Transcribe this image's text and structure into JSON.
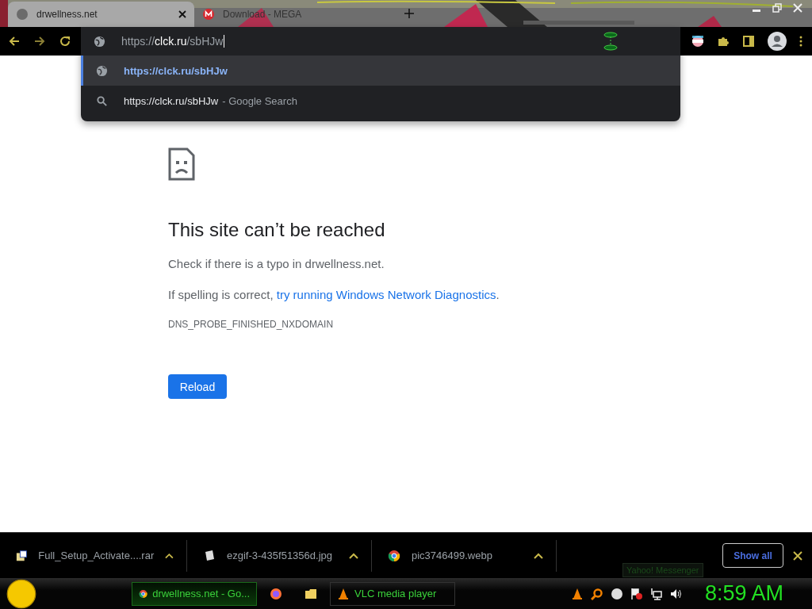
{
  "tabs": [
    {
      "title": "drwellness.net",
      "selected": true,
      "kind": "globe"
    },
    {
      "title": "Download - MEGA",
      "selected": false,
      "kind": "mega"
    }
  ],
  "omnibox": {
    "scheme": "https://",
    "host": "clck.ru",
    "path": "/sbHJw"
  },
  "suggestions": [
    {
      "kind": "url",
      "text": "https://clck.ru/sbHJw",
      "selected": true
    },
    {
      "kind": "search",
      "text": "https://clck.ru/sbHJw",
      "suffix": "- Google Search",
      "selected": false
    }
  ],
  "error": {
    "title": "This site can’t be reached",
    "line_1": "Check if there is a typo in drwellness.net.",
    "line_2_before": "If spelling is correct, ",
    "line_2_link": "try running Windows Network Diagnostics",
    "line_2_after": ".",
    "code": "DNS_PROBE_FINISHED_NXDOMAIN",
    "button": "Reload"
  },
  "downloads": {
    "items": [
      {
        "name": "Full_Setup_Activate....rar",
        "kind": "archive"
      },
      {
        "name": "ezgif-3-435f51356d.jpg"
      },
      {
        "name": "pic3746499.webp",
        "kind": "chrome"
      }
    ],
    "show_all": "Show all"
  },
  "taskbar": {
    "windows": [
      {
        "title": "drwellness.net - Go...",
        "kind": "chrome",
        "active": true
      },
      {
        "kind": "firefox",
        "active": false
      },
      {
        "kind": "folder",
        "active": false
      },
      {
        "title": "VLC media player",
        "kind": "vlc",
        "active": false
      }
    ],
    "tooltip": "Yahoo! Messenger",
    "clock": "8:59 AM"
  }
}
